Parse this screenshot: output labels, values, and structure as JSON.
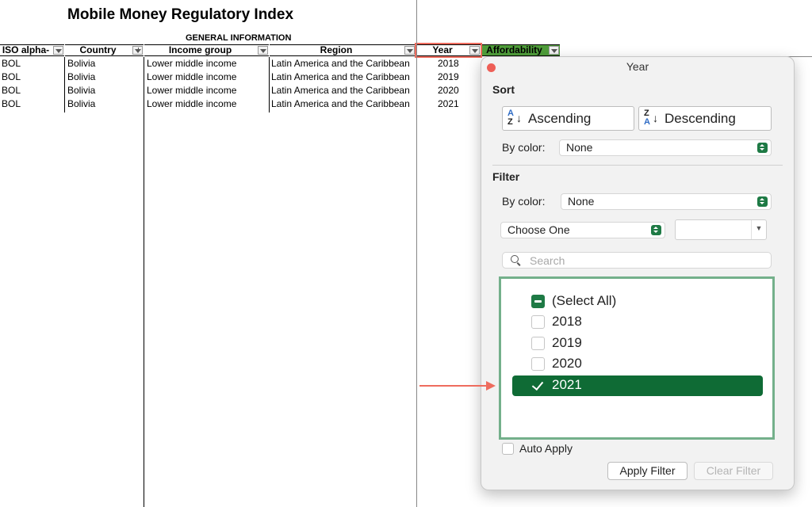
{
  "sheet": {
    "title": "Mobile Money Regulatory Index",
    "section": "GENERAL INFORMATION",
    "headers": {
      "iso": "ISO alpha-",
      "country": "Country",
      "income": "Income group",
      "region": "Region",
      "year": "Year",
      "affordability": "Affordability"
    },
    "rows": [
      {
        "iso": "BOL",
        "country": "Bolivia",
        "income": "Lower middle income",
        "region": "Latin America and the Caribbean",
        "year": "2018"
      },
      {
        "iso": "BOL",
        "country": "Bolivia",
        "income": "Lower middle income",
        "region": "Latin America and the Caribbean",
        "year": "2019"
      },
      {
        "iso": "BOL",
        "country": "Bolivia",
        "income": "Lower middle income",
        "region": "Latin America and the Caribbean",
        "year": "2020"
      },
      {
        "iso": "BOL",
        "country": "Bolivia",
        "income": "Lower middle income",
        "region": "Latin America and the Caribbean",
        "year": "2021"
      }
    ]
  },
  "popup": {
    "title": "Year",
    "sort": {
      "heading": "Sort",
      "ascending": "Ascending",
      "descending": "Descending",
      "by_color_label": "By color:",
      "by_color_value": "None"
    },
    "filter": {
      "heading": "Filter",
      "by_color_label": "By color:",
      "by_color_value": "None",
      "choose": "Choose One",
      "combo_value": "",
      "search_placeholder": "Search",
      "items": [
        {
          "label": "(Select All)",
          "state": "mixed"
        },
        {
          "label": "2018",
          "state": "unchecked"
        },
        {
          "label": "2019",
          "state": "unchecked"
        },
        {
          "label": "2020",
          "state": "unchecked"
        },
        {
          "label": "2021",
          "state": "checked"
        }
      ],
      "auto_apply": "Auto Apply",
      "apply": "Apply Filter",
      "clear": "Clear Filter"
    }
  },
  "colors": {
    "highlight_box": "#ee6c5e",
    "pointer_arrow": "#ee6c5e",
    "affordability_header": "#4f9d3a",
    "selected_item": "#0f6b35",
    "list_border": "#74b08b"
  }
}
